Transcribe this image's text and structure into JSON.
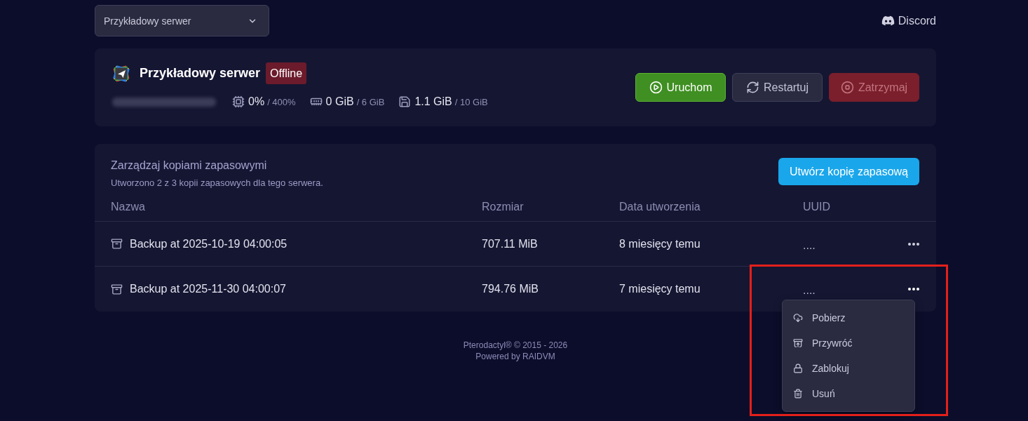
{
  "server_select": {
    "value": "Przykładowy serwer"
  },
  "header_links": [
    {
      "kind": "discord",
      "label": "Discord"
    }
  ],
  "server": {
    "name": "Przykładowy serwer",
    "status": {
      "kind": "offline",
      "label": "Offline"
    },
    "stats": [
      {
        "kind": "cpu",
        "value": "0%",
        "limit": "/ 400%"
      },
      {
        "kind": "memory",
        "value": "0 GiB",
        "limit": "/ 6 GiB"
      },
      {
        "kind": "disk",
        "value": "1.1 GiB",
        "limit": "/ 10 GiB"
      }
    ]
  },
  "power_buttons": [
    {
      "kind": "start",
      "label": "Uruchom",
      "disabled": false
    },
    {
      "kind": "restart",
      "label": "Restartuj",
      "disabled": false
    },
    {
      "kind": "stop",
      "label": "Zatrzymaj",
      "disabled": true
    }
  ],
  "backups": {
    "title": "Zarządzaj kopiami zapasowymi",
    "subtitle": "Utworzono 2 z 3 kopii zapasowych dla tego serwera.",
    "create_button": "Utwórz kopię zapasową",
    "columns": [
      "Nazwa",
      "Rozmiar",
      "Data utworzenia",
      "UUID"
    ],
    "rows": [
      {
        "name": "Backup at 2025-10-19 04:00:05",
        "size": "707.11 MiB",
        "created": "8 miesięcy temu",
        "uuid": "....",
        "menu_open": false
      },
      {
        "name": "Backup at 2025-11-30 04:00:07",
        "size": "794.76 MiB",
        "created": "7 miesięcy temu",
        "uuid": "....",
        "menu_open": true
      }
    ]
  },
  "backup_menu": {
    "items": [
      {
        "kind": "download",
        "label": "Pobierz"
      },
      {
        "kind": "restore",
        "label": "Przywróć"
      },
      {
        "kind": "lock",
        "label": "Zablokuj"
      },
      {
        "kind": "delete",
        "label": "Usuń"
      }
    ]
  },
  "footer": {
    "lines": [
      "Pterodactyl® © 2015 - 2026",
      "Powered by RAIDVM"
    ]
  }
}
